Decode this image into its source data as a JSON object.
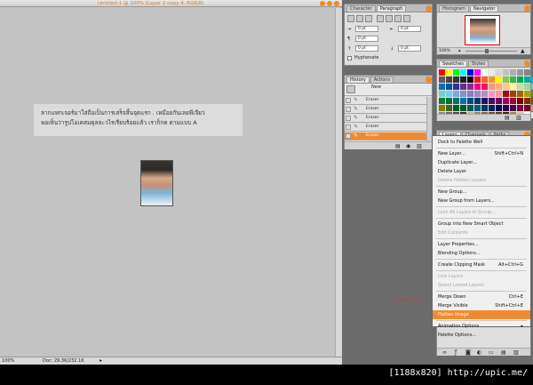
{
  "document": {
    "title": "Untitled-1 @ 100% (Layer 2 copy 4, RGB/8)",
    "zoom": "100%",
    "doc_info": "Doc: 29.3K/232.1K"
  },
  "canvas_text": {
    "line1": "ลากแทกเจอร์มาใส่ถือเป็นการเสร็จสิ้นจุดแรก .    เหมือยกันเลยพีเจียว",
    "line2": "พอเห็นว่ารูปโอเคสมดุลละวไรเรียบร้อยแล้ว เราก็กด ตามแบบ A"
  },
  "panel_char_para": {
    "tabs": [
      "Character",
      "Paragraph"
    ],
    "active_tab": "Paragraph",
    "fields": [
      "0 pt",
      "0 pt",
      "0 pt",
      "0 pt",
      "0 pt"
    ],
    "hyphenate_label": "Hyphenate"
  },
  "panel_nav": {
    "tabs": [
      "Histogram",
      "Navigator"
    ],
    "active_tab": "Navigator",
    "zoom_value": "100%"
  },
  "panel_history": {
    "tabs": [
      "History",
      "Actions"
    ],
    "active_tab": "History",
    "new_label": "New",
    "states": [
      "Eraser",
      "Eraser",
      "Eraser",
      "Eraser",
      "Eraser"
    ],
    "selected_index": 4
  },
  "panel_swatches": {
    "tabs": [
      "Swatches",
      "Styles"
    ],
    "active_tab": "Swatches",
    "colors": [
      "#ff0000",
      "#ffff00",
      "#00ff00",
      "#00ffff",
      "#0000ff",
      "#ff00ff",
      "#ffffff",
      "#ebebeb",
      "#d6d6d6",
      "#c2c2c2",
      "#adadad",
      "#999999",
      "#858585",
      "#707070",
      "#5c5c5c",
      "#474747",
      "#333333",
      "#1f1f1f",
      "#000000",
      "#ed1c24",
      "#f26522",
      "#f7941d",
      "#fff200",
      "#8dc63f",
      "#39b54a",
      "#00a651",
      "#00a99d",
      "#00aeef",
      "#0072bc",
      "#0054a6",
      "#2e3192",
      "#662d91",
      "#92278f",
      "#ec008c",
      "#ed145b",
      "#f69679",
      "#f9ad81",
      "#fdc68a",
      "#fff799",
      "#c4df9b",
      "#a3d39c",
      "#82ca9d",
      "#7accc8",
      "#6dcff6",
      "#7da7d9",
      "#8393ca",
      "#8781bd",
      "#a187be",
      "#bd8cbf",
      "#f49ac2",
      "#f6989d",
      "#9e0b0f",
      "#a0410d",
      "#a36209",
      "#aba000",
      "#598527",
      "#197b30",
      "#007236",
      "#00746b",
      "#0076a3",
      "#004b80",
      "#003471",
      "#1b1464",
      "#440e62",
      "#630460",
      "#9e005d",
      "#9e0039",
      "#790000",
      "#7b2e00",
      "#7d4900",
      "#827b00",
      "#406618",
      "#005e20",
      "#005826",
      "#005952",
      "#005b7f",
      "#003663",
      "#002157",
      "#0d004c",
      "#32004b",
      "#4b0049",
      "#7b0046",
      "#7a0026",
      "#c69c6d",
      "#998675",
      "#736357",
      "#534741",
      "#37302d",
      "#c7b299",
      "#998675",
      "#8c6239",
      "#754c24",
      "#603913",
      "#3c2415",
      "#a67c52",
      "#d9c8b4",
      "#ffffff",
      "#e6e6e6"
    ]
  },
  "panel_layers": {
    "tabs": [
      "Layers",
      "Channels",
      "Paths"
    ],
    "active_tab": "Layers"
  },
  "layers_menu": {
    "items": [
      {
        "label": "Dock to Palette Well",
        "shortcut": "",
        "disabled": false
      },
      {
        "label": "New Layer...",
        "shortcut": "Shift+Ctrl+N",
        "disabled": false
      },
      {
        "label": "Duplicate Layer...",
        "shortcut": "",
        "disabled": false
      },
      {
        "label": "Delete Layer",
        "shortcut": "",
        "disabled": false
      },
      {
        "label": "Delete Hidden Layers",
        "shortcut": "",
        "disabled": true
      },
      {
        "label": "New Group...",
        "shortcut": "",
        "disabled": false
      },
      {
        "label": "New Group from Layers...",
        "shortcut": "",
        "disabled": false
      },
      {
        "label": "Lock All Layers in Group...",
        "shortcut": "",
        "disabled": true
      },
      {
        "label": "Group into New Smart Object",
        "shortcut": "",
        "disabled": false
      },
      {
        "label": "Edit Contents",
        "shortcut": "",
        "disabled": true
      },
      {
        "label": "Layer Properties...",
        "shortcut": "",
        "disabled": false
      },
      {
        "label": "Blending Options...",
        "shortcut": "",
        "disabled": false
      },
      {
        "label": "Create Clipping Mask",
        "shortcut": "Alt+Ctrl+G",
        "disabled": false
      },
      {
        "label": "Link Layers",
        "shortcut": "",
        "disabled": true
      },
      {
        "label": "Select Linked Layers",
        "shortcut": "",
        "disabled": true
      },
      {
        "label": "Merge Down",
        "shortcut": "Ctrl+E",
        "disabled": false
      },
      {
        "label": "Merge Visible",
        "shortcut": "Shift+Ctrl+E",
        "disabled": false
      },
      {
        "label": "Flatten Image",
        "shortcut": "",
        "disabled": false,
        "highlighted": true
      },
      {
        "label": "Animation Options",
        "shortcut": "▸",
        "disabled": false
      },
      {
        "label": "Palette Options...",
        "shortcut": "",
        "disabled": false
      }
    ]
  },
  "annotation": {
    "flatten_note": "ลบแบบ A >>>"
  },
  "watermark": "[1188x820] http://upic.me/",
  "colors": {
    "accent": "#f08a30",
    "title_text": "#e07b25"
  }
}
